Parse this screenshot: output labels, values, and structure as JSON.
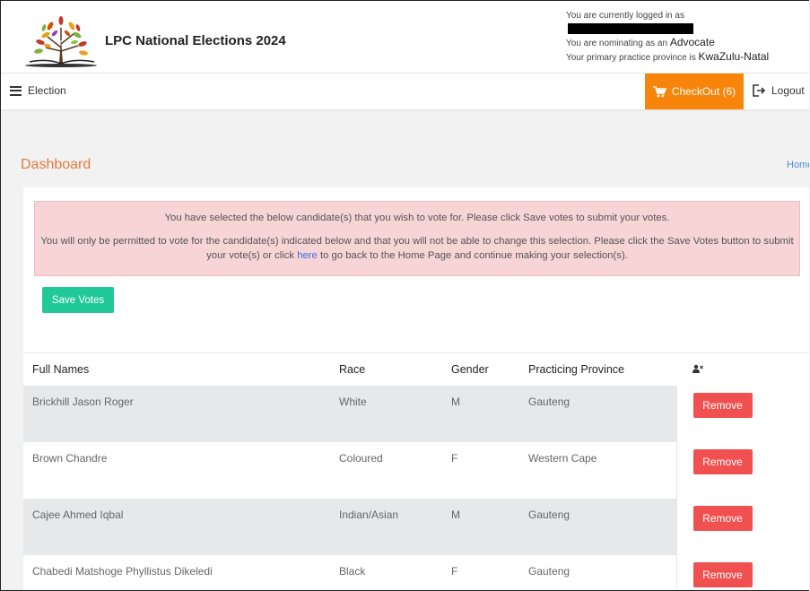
{
  "header": {
    "site_title": "LPC National Elections 2024",
    "logged_in_prefix": "You are currently logged in as",
    "nominating_prefix": "You are nominating as an",
    "nominating_role": "Advocate",
    "province_prefix": "Your primary practice province is",
    "province": "KwaZulu-Natal"
  },
  "navbar": {
    "election_label": "Election",
    "checkout_label": "CheckOut (6)",
    "logout_label": "Logout"
  },
  "page": {
    "title": "Dashboard",
    "breadcrumb": "Home"
  },
  "alert": {
    "line1": "You have selected the below candidate(s) that you wish to vote for. Please click Save votes to submit your votes.",
    "line2_pre": "You will only be permitted to vote for the candidate(s) indicated below and that you will not be able to change this selection. Please click the Save Votes button to submit your vote(s) or click",
    "link": "here",
    "line2_post": "to go back to the Home Page and continue making your selection(s)."
  },
  "save_votes_label": "Save Votes",
  "table": {
    "headers": [
      "Full Names",
      "Race",
      "Gender",
      "Practicing Province"
    ],
    "remove_label": "Remove",
    "rows": [
      {
        "name": "Brickhill Jason Roger",
        "race": "White",
        "gender": "M",
        "province": "Gauteng"
      },
      {
        "name": "Brown Chandre",
        "race": "Coloured",
        "gender": "F",
        "province": "Western Cape"
      },
      {
        "name": "Cajee Ahmed Iqbal",
        "race": "Indian/Asian",
        "gender": "M",
        "province": "Gauteng"
      },
      {
        "name": "Chabedi Matshoge Phyllistus Dikeledi",
        "race": "Black",
        "gender": "F",
        "province": "Gauteng"
      }
    ]
  },
  "colors": {
    "accent_orange": "#f7850c",
    "title_orange": "#e8793a",
    "save_green": "#20c997",
    "remove_red": "#f05050",
    "alert_bg": "#f7d4d6"
  }
}
